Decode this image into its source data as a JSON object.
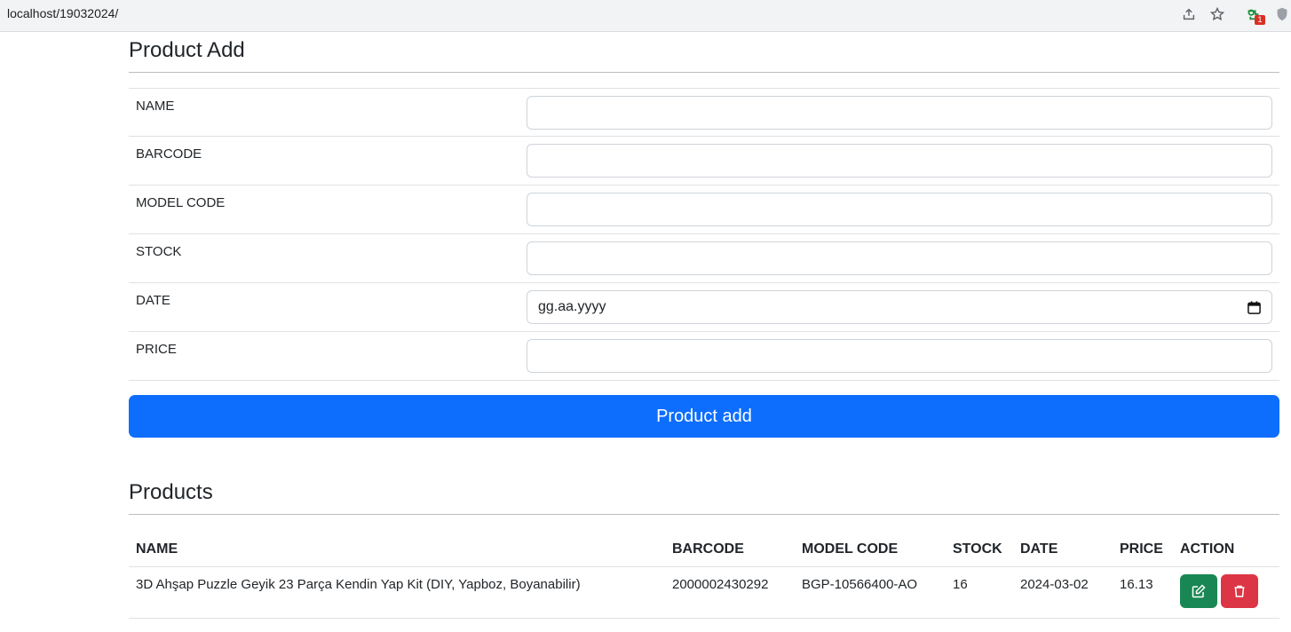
{
  "browser": {
    "url": "localhost/19032024/",
    "extension_badge": "1",
    "icons": [
      "share-icon",
      "star-icon",
      "extension-icon",
      "shield-icon"
    ]
  },
  "form": {
    "title": "Product Add",
    "fields": [
      {
        "label": "NAME",
        "value": ""
      },
      {
        "label": "BARCODE",
        "value": ""
      },
      {
        "label": "MODEL CODE",
        "value": ""
      },
      {
        "label": "STOCK",
        "value": ""
      },
      {
        "label": "DATE",
        "placeholder": "gg.aa.yyyy"
      },
      {
        "label": "PRICE",
        "value": ""
      }
    ],
    "submit_label": "Product add"
  },
  "products": {
    "title": "Products",
    "columns": [
      "NAME",
      "BARCODE",
      "MODEL CODE",
      "STOCK",
      "DATE",
      "PRICE",
      "ACTION"
    ],
    "rows": [
      {
        "name": "3D Ahşap Puzzle Geyik 23 Parça Kendin Yap Kit (DIY, Yapboz, Boyanabilir)",
        "barcode": "2000002430292",
        "model_code": "BGP-10566400-AO",
        "stock": "16",
        "date": "2024-03-02",
        "price": "16.13",
        "actions": [
          "edit-icon",
          "trash-icon"
        ]
      }
    ]
  },
  "colors": {
    "primary": "#0d6efd",
    "success": "#198754",
    "danger": "#dc3545"
  }
}
